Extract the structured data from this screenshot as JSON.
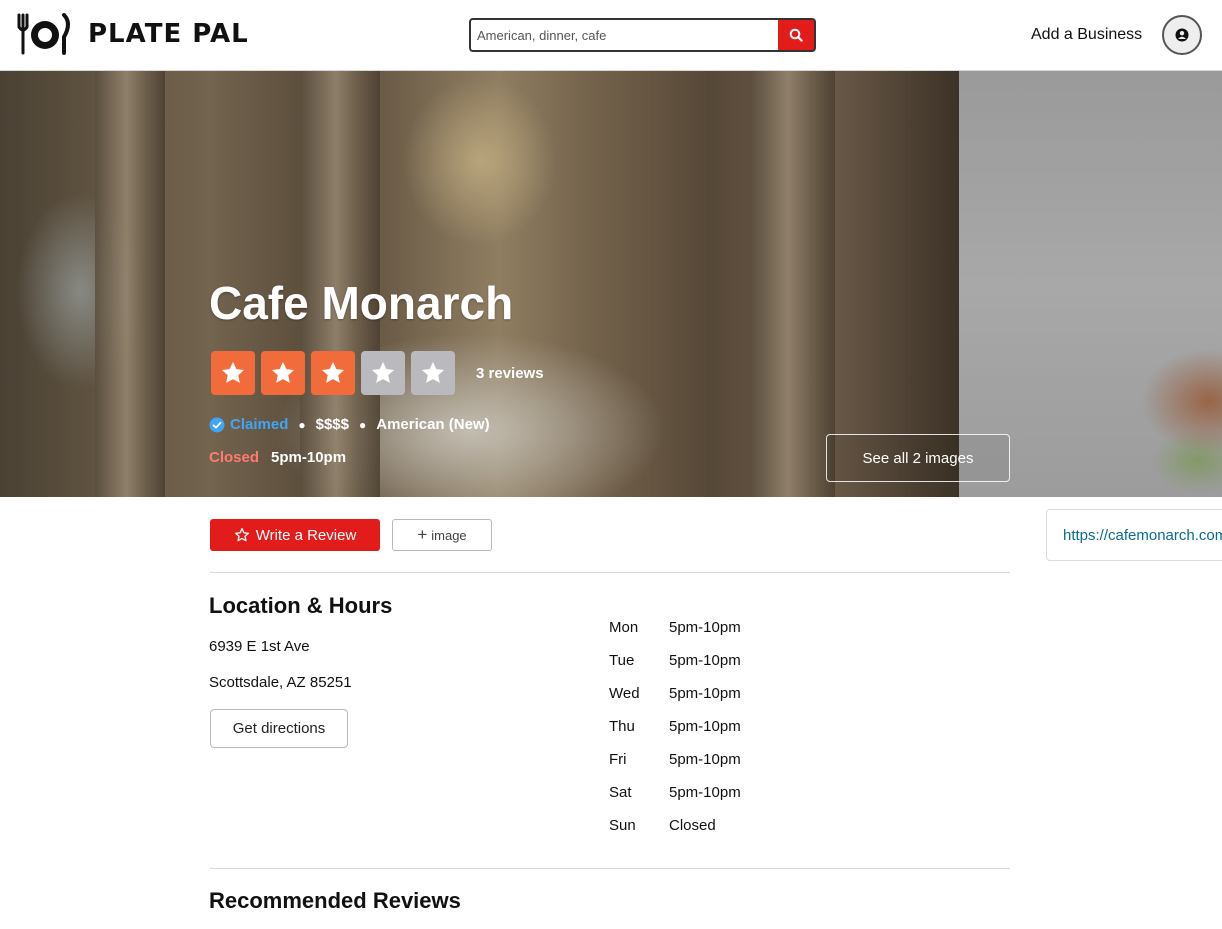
{
  "header": {
    "brand": "PLATE PAL",
    "search_placeholder": "American, dinner, cafe",
    "add_business": "Add a Business"
  },
  "business": {
    "name": "Cafe Monarch",
    "rating_stars": 3,
    "max_stars": 5,
    "review_count": "3 reviews",
    "claimed": "Claimed",
    "price": "$$$$",
    "category": "American (New)",
    "open_status": "Closed",
    "hours_today": "5pm-10pm",
    "see_all_images": "See all 2 images",
    "website": "https://cafemonarch.com"
  },
  "actions": {
    "write_review": "Write a Review",
    "add_image": "image"
  },
  "location": {
    "title": "Location & Hours",
    "address_line1": "6939 E 1st Ave",
    "address_line2": "Scottsdale, AZ 85251",
    "directions": "Get directions",
    "hours": [
      {
        "day": "Mon",
        "time": "5pm-10pm"
      },
      {
        "day": "Tue",
        "time": "5pm-10pm"
      },
      {
        "day": "Wed",
        "time": "5pm-10pm"
      },
      {
        "day": "Thu",
        "time": "5pm-10pm"
      },
      {
        "day": "Fri",
        "time": "5pm-10pm"
      },
      {
        "day": "Sat",
        "time": "5pm-10pm"
      },
      {
        "day": "Sun",
        "time": "Closed"
      }
    ]
  },
  "reviews": {
    "title": "Recommended Reviews"
  },
  "colors": {
    "accent_red": "#e21b1b",
    "star_on": "#f26b3a",
    "star_off": "#b9b9be",
    "claimed_blue": "#41a5f5",
    "closed_red": "#ff7b70",
    "link": "#0a6c8f"
  },
  "icons": {
    "logo": "plate-fork-knife-icon",
    "search": "search-icon",
    "user": "user-circle-icon",
    "star": "star-icon",
    "verified": "check-circle-icon",
    "plus": "plus-icon"
  }
}
